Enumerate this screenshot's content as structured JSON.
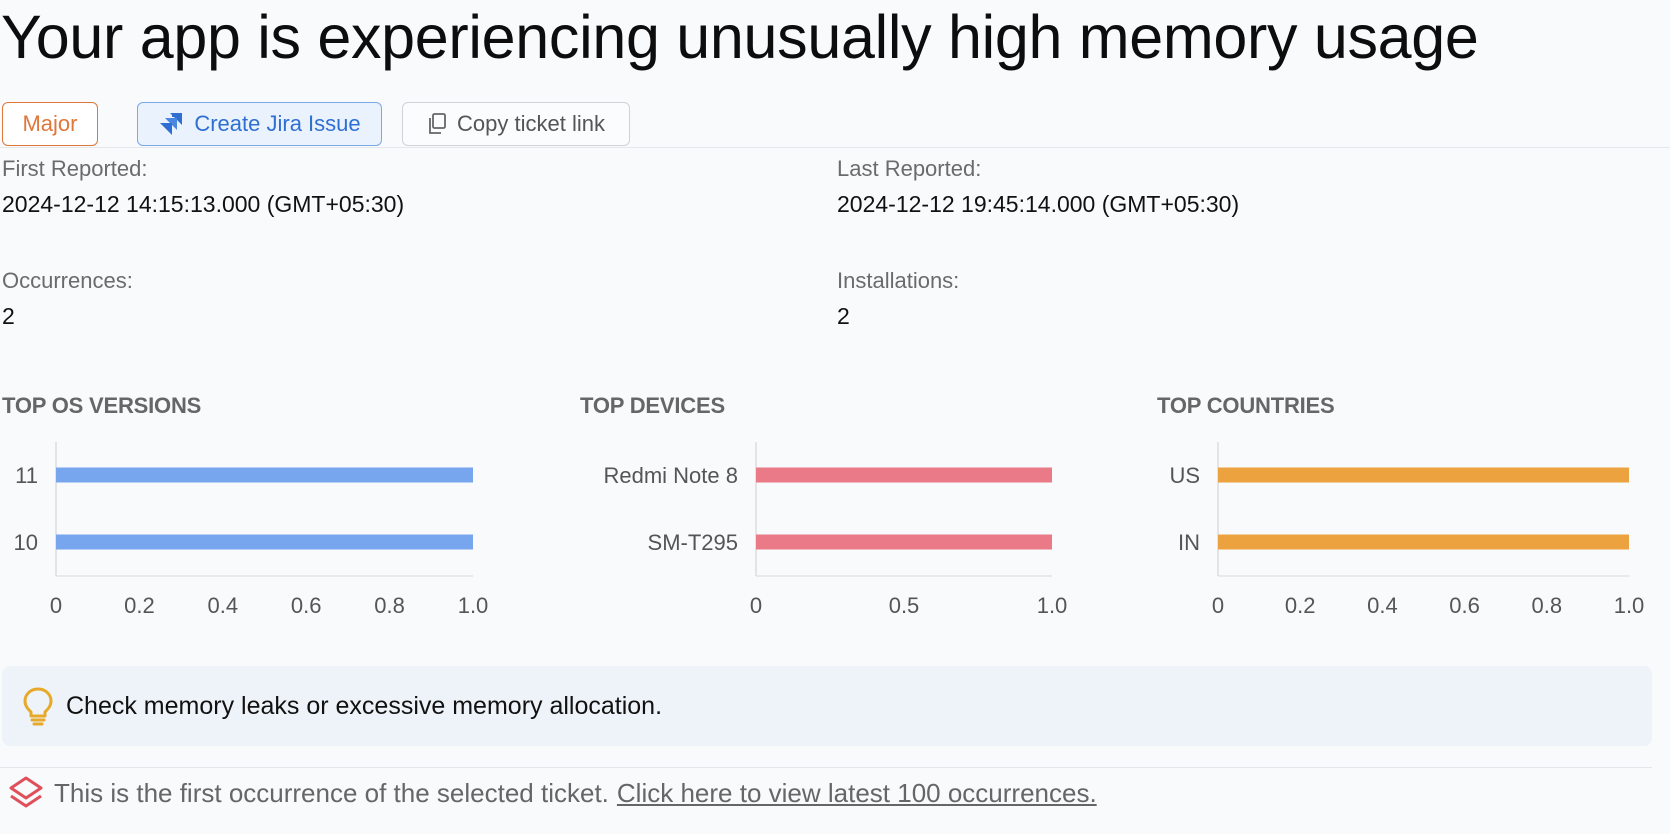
{
  "header": {
    "title": "Your app is experiencing unusually high memory usage"
  },
  "actions": {
    "severity_label": "Major",
    "jira_label": "Create Jira Issue",
    "copy_label": "Copy ticket link"
  },
  "stats": {
    "first_reported_label": "First Reported:",
    "first_reported_value": "2024-12-12 14:15:13.000 (GMT+05:30)",
    "last_reported_label": "Last Reported:",
    "last_reported_value": "2024-12-12 19:45:14.000 (GMT+05:30)",
    "occurrences_label": "Occurrences:",
    "occurrences_value": "2",
    "installations_label": "Installations:",
    "installations_value": "2"
  },
  "colors": {
    "os": "#78a6ee",
    "devices": "#ea7a87",
    "countries": "#eca23f",
    "severity": "#e0773a",
    "jira": "#2f6fd1"
  },
  "chart_data": [
    {
      "type": "bar",
      "orientation": "horizontal",
      "title": "TOP OS VERSIONS",
      "categories": [
        "11",
        "10"
      ],
      "values": [
        1,
        1
      ],
      "xlim": [
        0,
        1
      ],
      "xticks": [
        "0",
        "0.2",
        "0.4",
        "0.6",
        "0.8",
        "1.0"
      ],
      "color": "#78a6ee"
    },
    {
      "type": "bar",
      "orientation": "horizontal",
      "title": "TOP DEVICES",
      "categories": [
        "Redmi Note 8",
        "SM-T295"
      ],
      "values": [
        1,
        1
      ],
      "xlim": [
        0,
        1
      ],
      "xticks": [
        "0",
        "0.5",
        "1.0"
      ],
      "color": "#ea7a87"
    },
    {
      "type": "bar",
      "orientation": "horizontal",
      "title": "TOP COUNTRIES",
      "categories": [
        "US",
        "IN"
      ],
      "values": [
        1,
        1
      ],
      "xlim": [
        0,
        1
      ],
      "xticks": [
        "0",
        "0.2",
        "0.4",
        "0.6",
        "0.8",
        "1.0"
      ],
      "color": "#eca23f"
    }
  ],
  "tip": {
    "icon": "lightbulb-icon",
    "text": "Check memory leaks or excessive memory allocation."
  },
  "footer": {
    "icon": "layers-icon",
    "text": "This is the first occurrence of the selected ticket.",
    "link_text": "Click here to view latest 100 occurrences."
  }
}
